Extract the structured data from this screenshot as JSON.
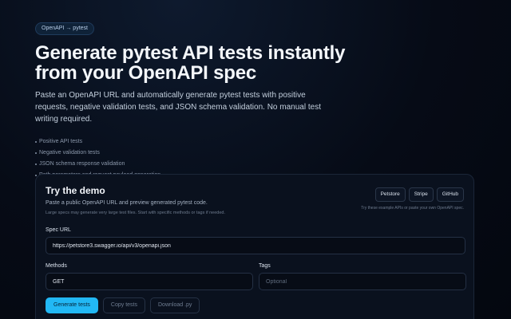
{
  "hero": {
    "badge": "OpenAPI → pytest",
    "title_line1": "Generate pytest API tests instantly",
    "title_line2": "from your OpenAPI spec",
    "subtitle": "Paste an OpenAPI URL and automatically generate pytest tests with positive requests, negative validation tests, and JSON schema validation. No manual test writing required.",
    "features": [
      "Positive API tests",
      "Negative validation tests",
      "JSON schema response validation",
      "Path parameters and request payload generation"
    ]
  },
  "demo": {
    "title": "Try the demo",
    "description": "Paste a public OpenAPI URL and preview generated pytest code.",
    "note": "Large specs may generate very large test files. Start with specific methods or tags if needed.",
    "examples": {
      "buttons": [
        "Petstore",
        "Stripe",
        "GitHub"
      ],
      "hint": "Try these example APIs or paste your own OpenAPI spec."
    },
    "spec_url": {
      "label": "Spec URL",
      "value": "https://petstore3.swagger.io/api/v3/openapi.json"
    },
    "methods": {
      "label": "Methods",
      "value": "GET"
    },
    "tags": {
      "label": "Tags",
      "placeholder": "Optional"
    },
    "actions": {
      "generate": "Generate tests",
      "copy": "Copy tests",
      "download": "Download .py"
    }
  },
  "colors": {
    "background": "#060b16",
    "accent": "#22b8f5",
    "card": "#0a111e"
  }
}
